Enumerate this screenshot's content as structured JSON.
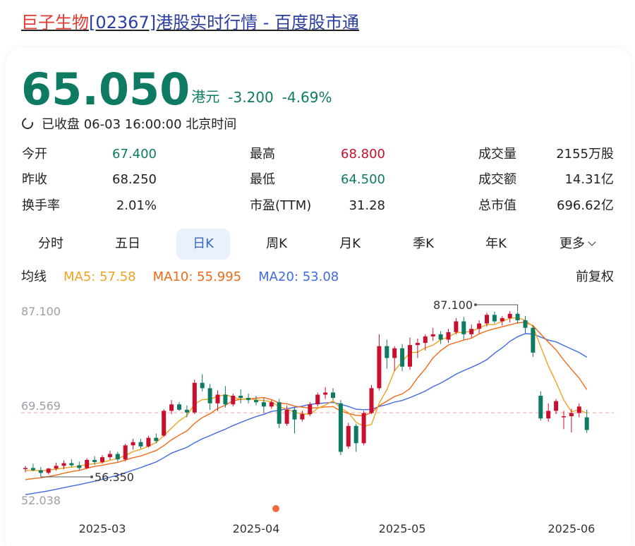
{
  "page": {
    "title_name": "巨子生物",
    "title_rest": "[02367]港股实时行情 - 百度股市通"
  },
  "quote": {
    "price": "65.050",
    "currency": "港元",
    "change": "-3.200",
    "change_pct": "-4.69%",
    "status": "已收盘 06-03 16:00:00 北京时间"
  },
  "stats": [
    {
      "label": "今开",
      "value": "67.400"
    },
    {
      "label": "最高",
      "value": "68.800"
    },
    {
      "label": "成交量",
      "value": "2155万股"
    },
    {
      "label": "昨收",
      "value": "68.250"
    },
    {
      "label": "最低",
      "value": "64.500"
    },
    {
      "label": "成交额",
      "value": "14.31亿"
    },
    {
      "label": "换手率",
      "value": "2.01%"
    },
    {
      "label": "市盈(TTM)",
      "value": "31.28"
    },
    {
      "label": "总市值",
      "value": "696.62亿"
    }
  ],
  "tabs": [
    {
      "label": "分时"
    },
    {
      "label": "五日"
    },
    {
      "label": "日K"
    },
    {
      "label": "周K"
    },
    {
      "label": "月K"
    },
    {
      "label": "季K"
    },
    {
      "label": "年K"
    },
    {
      "label": "更多"
    }
  ],
  "ma_legend": {
    "label": "均线",
    "ma5": "MA5: 57.58",
    "ma10": "MA10: 55.995",
    "ma20": "MA20: 53.08",
    "adjust": "前复权"
  },
  "colors": {
    "up": "#c8102e",
    "down": "#0e7a62",
    "ma5": "#f0a31e",
    "ma10": "#ef6a16",
    "ma20": "#4169e1",
    "prev_close_line": "#f3a3a3"
  },
  "chart_data": {
    "type": "candlestick",
    "y_ticks": [
      "87.100",
      "69.569",
      "52.038"
    ],
    "ylim": [
      52.038,
      87.1
    ],
    "x_ticks": [
      {
        "label": "2025-03",
        "index": 10
      },
      {
        "label": "2025-04",
        "index": 30
      },
      {
        "label": "2025-05",
        "index": 49
      },
      {
        "label": "2025-06",
        "index": 71
      }
    ],
    "annotations": {
      "high": {
        "label": "87.100",
        "value": 87.1,
        "index": 64
      },
      "low": {
        "label": "56.350",
        "value": 56.35,
        "index": 2
      }
    },
    "prev_close": 68.25,
    "ohlc": [
      [
        57.8,
        58.4,
        57.2,
        58.0
      ],
      [
        58.0,
        58.8,
        57.4,
        57.6
      ],
      [
        57.6,
        58.2,
        56.35,
        57.1
      ],
      [
        57.1,
        58.0,
        56.8,
        57.9
      ],
      [
        57.9,
        59.0,
        57.5,
        58.4
      ],
      [
        58.4,
        59.4,
        57.8,
        58.9
      ],
      [
        58.9,
        59.6,
        58.2,
        58.5
      ],
      [
        58.5,
        59.2,
        57.6,
        58.0
      ],
      [
        58.0,
        59.8,
        57.8,
        59.5
      ],
      [
        59.5,
        60.2,
        58.6,
        59.1
      ],
      [
        59.1,
        60.4,
        58.8,
        60.0
      ],
      [
        60.0,
        61.2,
        59.5,
        60.6
      ],
      [
        60.6,
        61.0,
        59.2,
        59.6
      ],
      [
        59.6,
        62.5,
        59.2,
        62.2
      ],
      [
        62.2,
        63.4,
        61.4,
        62.8
      ],
      [
        62.8,
        63.4,
        61.6,
        62.0
      ],
      [
        62.0,
        64.0,
        61.8,
        63.6
      ],
      [
        63.6,
        64.4,
        62.6,
        63.0
      ],
      [
        64.0,
        68.9,
        63.8,
        68.6
      ],
      [
        68.6,
        70.6,
        68.0,
        69.8
      ],
      [
        69.8,
        70.2,
        68.6,
        68.8
      ],
      [
        68.8,
        69.6,
        67.4,
        68.3
      ],
      [
        68.3,
        74.4,
        68.0,
        73.8
      ],
      [
        73.8,
        75.4,
        72.2,
        72.8
      ],
      [
        72.8,
        73.6,
        68.8,
        70.0
      ],
      [
        70.0,
        72.4,
        68.6,
        71.6
      ],
      [
        71.6,
        73.2,
        69.2,
        69.8
      ],
      [
        69.8,
        71.8,
        69.4,
        71.4
      ],
      [
        71.4,
        72.6,
        70.0,
        71.0
      ],
      [
        71.0,
        71.8,
        70.0,
        70.6
      ],
      [
        70.6,
        71.4,
        69.6,
        70.2
      ],
      [
        70.2,
        71.0,
        68.2,
        69.4
      ],
      [
        69.4,
        70.6,
        69.0,
        70.2
      ],
      [
        70.2,
        70.8,
        65.4,
        66.2
      ],
      [
        66.2,
        69.6,
        65.8,
        68.8
      ],
      [
        68.8,
        69.2,
        64.4,
        67.0
      ],
      [
        67.0,
        68.6,
        66.6,
        68.0
      ],
      [
        68.0,
        70.2,
        67.6,
        69.8
      ],
      [
        69.8,
        72.0,
        69.4,
        71.6
      ],
      [
        71.6,
        73.0,
        70.8,
        72.0
      ],
      [
        72.0,
        72.8,
        70.6,
        71.0
      ],
      [
        70.0,
        70.6,
        60.4,
        61.0
      ],
      [
        62.0,
        66.4,
        61.6,
        65.8
      ],
      [
        65.8,
        66.2,
        61.0,
        62.6
      ],
      [
        62.6,
        68.6,
        62.2,
        68.2
      ],
      [
        68.2,
        73.4,
        68.0,
        72.8
      ],
      [
        72.8,
        82.8,
        72.4,
        80.6
      ],
      [
        80.6,
        81.8,
        76.4,
        78.4
      ],
      [
        78.4,
        80.6,
        76.0,
        80.2
      ],
      [
        80.2,
        81.0,
        76.0,
        76.8
      ],
      [
        76.8,
        82.2,
        76.2,
        80.8
      ],
      [
        80.8,
        82.0,
        78.4,
        81.2
      ],
      [
        81.2,
        82.8,
        79.8,
        82.4
      ],
      [
        82.4,
        84.0,
        81.6,
        82.8
      ],
      [
        82.8,
        83.4,
        81.0,
        81.8
      ],
      [
        81.8,
        83.8,
        81.2,
        83.2
      ],
      [
        83.2,
        85.8,
        82.8,
        85.2
      ],
      [
        85.2,
        86.0,
        81.8,
        82.8
      ],
      [
        82.8,
        84.6,
        82.2,
        83.8
      ],
      [
        83.8,
        85.4,
        83.0,
        84.8
      ],
      [
        84.8,
        86.8,
        84.2,
        86.4
      ],
      [
        86.4,
        87.0,
        84.8,
        85.2
      ],
      [
        85.2,
        86.2,
        84.4,
        85.8
      ],
      [
        85.8,
        87.1,
        85.0,
        86.6
      ],
      [
        86.6,
        87.0,
        84.8,
        85.4
      ],
      [
        85.4,
        86.2,
        83.0,
        84.0
      ],
      [
        84.0,
        84.4,
        78.6,
        79.4
      ],
      [
        71.4,
        72.2,
        66.8,
        67.2
      ],
      [
        67.2,
        70.0,
        66.6,
        68.6
      ],
      [
        68.6,
        70.8,
        68.0,
        70.4
      ],
      [
        67.4,
        68.6,
        65.2,
        67.6
      ],
      [
        67.6,
        69.0,
        64.6,
        68.2
      ],
      [
        68.2,
        70.0,
        67.4,
        69.4
      ],
      [
        67.4,
        68.8,
        64.5,
        65.05
      ]
    ],
    "ma5_last": 57.58,
    "ma10_last": 55.995,
    "ma20_last": 53.08
  }
}
